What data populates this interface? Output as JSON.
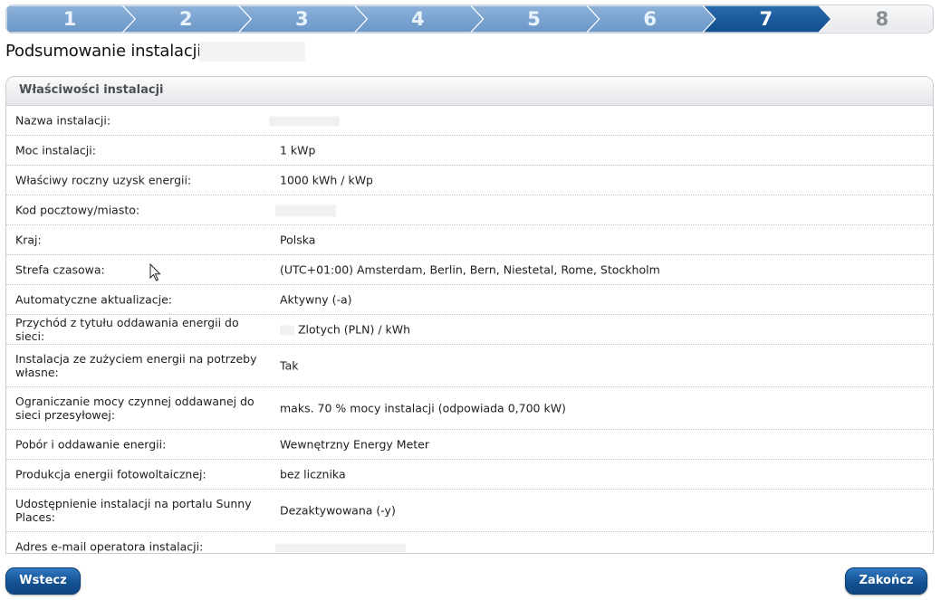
{
  "wizard": {
    "steps": [
      "1",
      "2",
      "3",
      "4",
      "5",
      "6",
      "7",
      "8"
    ],
    "current_step": 7,
    "colors": {
      "done": "#6a96c6",
      "active": "#0f4c8d",
      "future": "#e6e8eb"
    }
  },
  "page": {
    "title": "Podsumowanie instalacji"
  },
  "panel": {
    "header": "Właściwości instalacji",
    "rows": [
      {
        "label": "Nazwa instalacji:",
        "value": ""
      },
      {
        "label": "Moc instalacji:",
        "value": "1 kWp"
      },
      {
        "label": "Właściwy roczny uzysk energii:",
        "value": "1000 kWh / kWp"
      },
      {
        "label": "Kod pocztowy/miasto:",
        "value": ""
      },
      {
        "label": "Kraj:",
        "value": "Polska"
      },
      {
        "label": "Strefa czasowa:",
        "value": "(UTC+01:00) Amsterdam, Berlin, Bern, Niestetal, Rome, Stockholm"
      },
      {
        "label": "Automatyczne aktualizacje:",
        "value": "Aktywny (-a)"
      },
      {
        "label": "Przychód z tytułu oddawania energii do sieci:",
        "value": "Zlotych (PLN) / kWh"
      },
      {
        "label": "Instalacja ze zużyciem energii na potrzeby własne:",
        "value": "Tak"
      },
      {
        "label": "Ograniczanie mocy czynnej oddawanej do sieci przesyłowej:",
        "value": "maks. 70 % mocy instalacji (odpowiada 0,700 kW)"
      },
      {
        "label": "Pobór i oddawanie energii:",
        "value": "Wewnętrzny Energy Meter"
      },
      {
        "label": "Produkcja energii fotowoltaicznej:",
        "value": "bez licznika"
      },
      {
        "label": "Udostępnienie instalacji na portalu Sunny Places:",
        "value": "Dezaktywowana (-y)"
      },
      {
        "label": "Adres e-mail operatora instalacji:",
        "value": ""
      }
    ]
  },
  "buttons": {
    "back": "Wstecz",
    "finish": "Zakończ"
  }
}
